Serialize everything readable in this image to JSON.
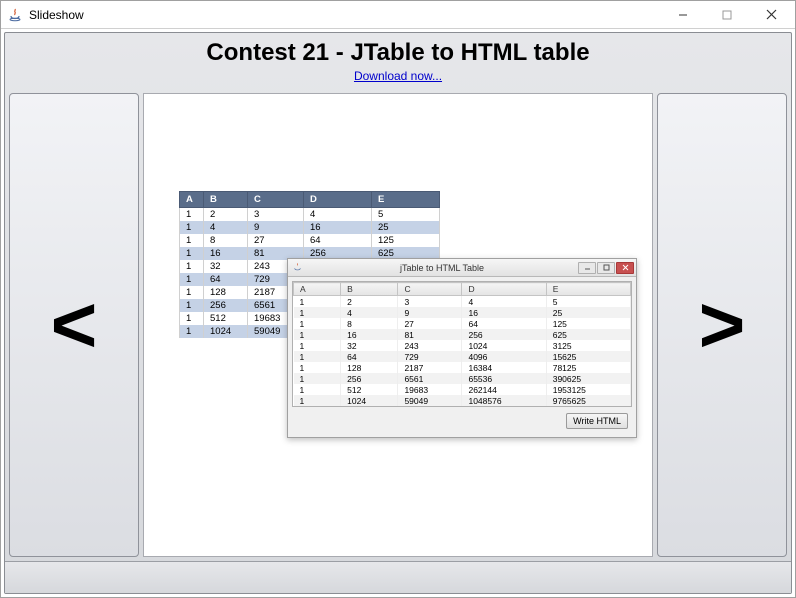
{
  "window": {
    "title": "Slideshow"
  },
  "header": {
    "title": "Contest 21 - JTable to HTML table",
    "download": "Download now..."
  },
  "nav": {
    "prev": "<",
    "next": ">"
  },
  "back_table": {
    "headers": [
      "A",
      "B",
      "C",
      "D",
      "E"
    ],
    "rows": [
      [
        "1",
        "2",
        "3",
        "4",
        "5"
      ],
      [
        "1",
        "4",
        "9",
        "16",
        "25"
      ],
      [
        "1",
        "8",
        "27",
        "64",
        "125"
      ],
      [
        "1",
        "16",
        "81",
        "256",
        "625"
      ],
      [
        "1",
        "32",
        "243",
        "1024",
        "3125"
      ],
      [
        "1",
        "64",
        "729",
        "",
        ""
      ],
      [
        "1",
        "128",
        "2187",
        "",
        ""
      ],
      [
        "1",
        "256",
        "6561",
        "",
        ""
      ],
      [
        "1",
        "512",
        "19683",
        "",
        ""
      ],
      [
        "1",
        "1024",
        "59049",
        "",
        ""
      ]
    ]
  },
  "inner_window": {
    "title": "jTable to HTML Table",
    "button": "Write HTML",
    "headers": [
      "A",
      "B",
      "C",
      "D",
      "E"
    ],
    "rows": [
      [
        "1",
        "2",
        "3",
        "4",
        "5"
      ],
      [
        "1",
        "4",
        "9",
        "16",
        "25"
      ],
      [
        "1",
        "8",
        "27",
        "64",
        "125"
      ],
      [
        "1",
        "16",
        "81",
        "256",
        "625"
      ],
      [
        "1",
        "32",
        "243",
        "1024",
        "3125"
      ],
      [
        "1",
        "64",
        "729",
        "4096",
        "15625"
      ],
      [
        "1",
        "128",
        "2187",
        "16384",
        "78125"
      ],
      [
        "1",
        "256",
        "6561",
        "65536",
        "390625"
      ],
      [
        "1",
        "512",
        "19683",
        "262144",
        "1953125"
      ],
      [
        "1",
        "1024",
        "59049",
        "1048576",
        "9765625"
      ]
    ]
  }
}
